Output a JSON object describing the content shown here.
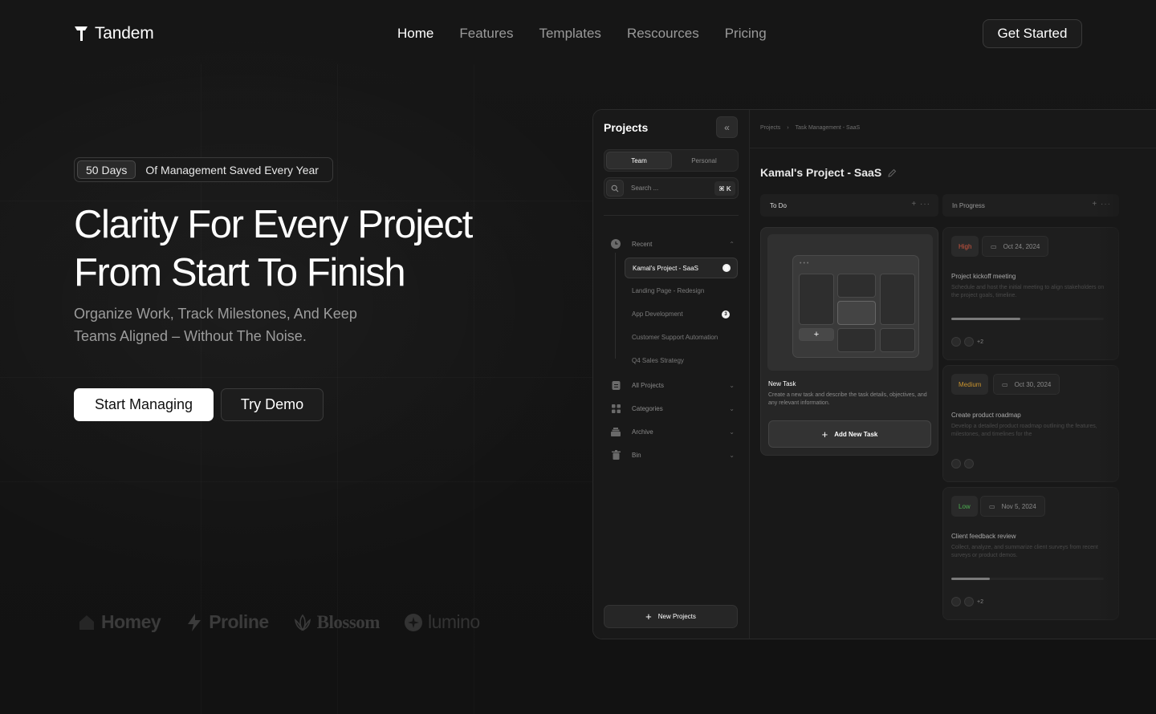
{
  "brand": {
    "name": "Tandem"
  },
  "nav": {
    "links": [
      {
        "label": "Home",
        "active": true
      },
      {
        "label": "Features",
        "active": false
      },
      {
        "label": "Templates",
        "active": false
      },
      {
        "label": "Rescources",
        "active": false
      },
      {
        "label": "Pricing",
        "active": false
      }
    ],
    "cta": "Get Started"
  },
  "hero": {
    "badge_pill": "50 Days",
    "badge_text": "Of Management Saved Every Year",
    "title_line1": "Clarity For Every Project",
    "title_line2": "From Start To Finish",
    "subtitle_line1": "Organize Work, Track Milestones, And Keep",
    "subtitle_line2": "Teams Aligned – Without The Noise.",
    "primary_button": "Start Managing",
    "secondary_button": "Try Demo"
  },
  "partner_logos": [
    "Homey",
    "Proline",
    "Blossom",
    "lumino"
  ],
  "app": {
    "sidebar": {
      "title": "Projects",
      "tabs": [
        "Team",
        "Personal"
      ],
      "active_tab": "Team",
      "search_placeholder": "Search ...",
      "search_shortcut": "⌘ K",
      "recent_label": "Recent",
      "recent_items": [
        {
          "label": "Kamal's Project - SaaS",
          "count": "8",
          "active": true
        },
        {
          "label": "Landing Page - Redesign",
          "count": "",
          "active": false
        },
        {
          "label": "App Development",
          "count": "3",
          "active": false
        },
        {
          "label": "Customer Support Automation",
          "count": "",
          "active": false
        },
        {
          "label": "Q4 Sales Strategy",
          "count": "",
          "active": false
        }
      ],
      "sections": [
        {
          "label": "All Projects",
          "icon": "clipboard-icon"
        },
        {
          "label": "Categories",
          "icon": "grid-icon"
        },
        {
          "label": "Archive",
          "icon": "archive-icon"
        },
        {
          "label": "Bin",
          "icon": "trash-icon"
        }
      ],
      "new_button": "New Projects"
    },
    "main": {
      "breadcrumb": [
        "Projects",
        "Task Management - SaaS"
      ],
      "title": "Kamal's Project - SaaS",
      "columns": [
        "To Do",
        "In Progress"
      ],
      "new_task": {
        "title": "New Task",
        "description": "Create a new task and describe the task details, objectives, and any relevant information.",
        "button": "Add New Task"
      },
      "tasks": [
        {
          "priority": "High",
          "priority_color": "#d0553f",
          "date": "Oct 24, 2024",
          "title": "Project kickoff meeting",
          "description": "Schedule and host the initial meeting to align stakeholders on the project goals, timeline.",
          "progress": 0.45,
          "extra_members": "+2"
        },
        {
          "priority": "Medium",
          "priority_color": "#c9932e",
          "date": "Oct 30, 2024",
          "title": "Create product roadmap",
          "description": "Develop a detailed product roadmap outlining the features, milestones, and timelines for the",
          "progress": 0,
          "extra_members": ""
        },
        {
          "priority": "Low",
          "priority_color": "#4caf50",
          "date": "Nov 5, 2024",
          "title": "Client feedback review",
          "description": "Collect, analyze, and summarize client surveys from recent surveys or product demos.",
          "progress": 0.25,
          "extra_members": "+2"
        }
      ]
    }
  }
}
